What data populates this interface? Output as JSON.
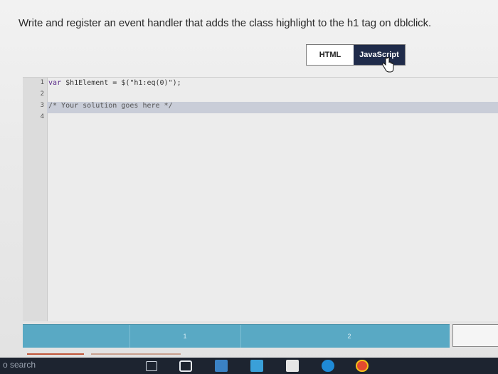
{
  "prompt": {
    "text": "Write and register an event handler that adds the class highlight to the h1 tag on dblclick."
  },
  "tabs": {
    "html_label": "HTML",
    "js_label": "JavaScript",
    "active": "JavaScript"
  },
  "editor": {
    "line_numbers": [
      "1",
      "2",
      "3",
      "4"
    ],
    "lines": [
      {
        "keyword": "var",
        "rest": " $h1Element = $(\"h1:eq(0)\");"
      },
      {
        "keyword": "",
        "rest": ""
      },
      {
        "keyword": "",
        "rest": "/* Your solution goes here */"
      },
      {
        "keyword": "",
        "rest": ""
      }
    ],
    "active_line": 3
  },
  "bottom_bar": {
    "segments": [
      "1",
      "2"
    ]
  },
  "taskbar": {
    "search_text": "o search",
    "icons": [
      "task-view-icon",
      "folder-icon",
      "store-icon",
      "mail-icon",
      "vscode-icon",
      "edge-icon",
      "chrome-icon"
    ]
  },
  "colors": {
    "js_tab_bg": "#1f2b4a",
    "bottom_bar": "#59a9c4",
    "taskbar": "#1d2430",
    "active_line": "#c9cdd8"
  }
}
